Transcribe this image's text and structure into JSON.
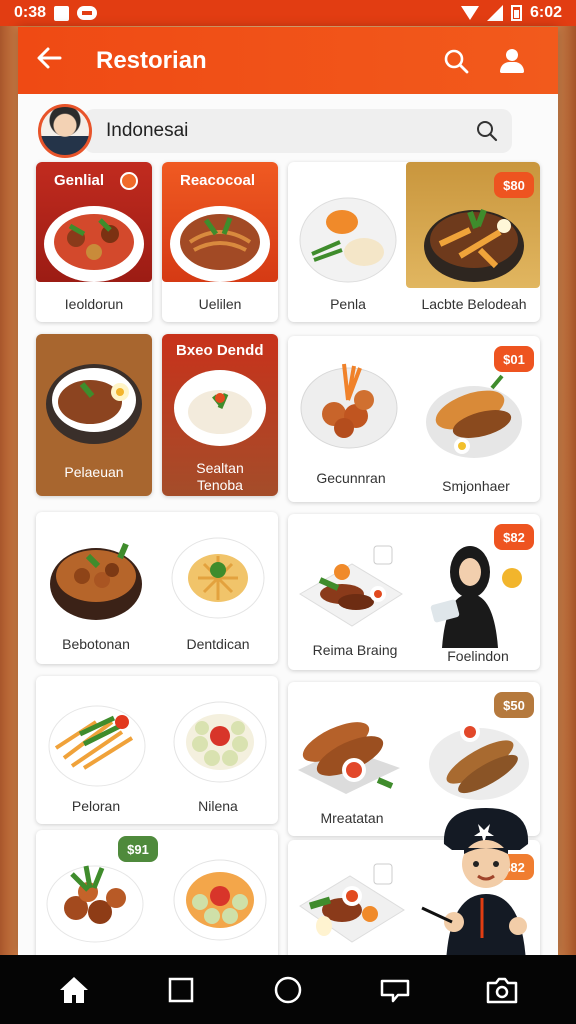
{
  "status": {
    "time": "0:38",
    "right_time": "6:02"
  },
  "appbar": {
    "title": "Restorian",
    "back_icon": "back-arrow-icon",
    "search_icon": "search-icon",
    "profile_icon": "user-icon"
  },
  "search": {
    "value": "Indonesai"
  },
  "cards": {
    "c1": {
      "header": "Genlial",
      "label": "Ieoldorun"
    },
    "c2": {
      "header": "Reacocoal",
      "label": "Uelilen"
    },
    "c3": {
      "label_left": "Penla",
      "label_right": "Lacbte Belodeah",
      "badge": "$80"
    },
    "c4": {
      "label": "Pelaeuan"
    },
    "c5": {
      "header": "Bxeo Dendd",
      "label_line1": "Sealtan",
      "label_line2": "Tenoba"
    },
    "c6": {
      "label_left": "Gecunnran",
      "label_right": "Smjonhaer",
      "badge": "$01"
    },
    "c7": {
      "label_left": "Bebotonan",
      "label_right": "Dentdican"
    },
    "c8": {
      "label_left": "Reima Braing",
      "label_right": "Foelindon",
      "badge": "$82"
    },
    "c9": {
      "label_left": "Peloran",
      "label_right": "Nilena"
    },
    "c10": {
      "label": "Mreatatan",
      "badge": "$50"
    },
    "c11": {
      "badge": "$91"
    },
    "c12": {
      "badge": "$82"
    }
  },
  "colors": {
    "accent": "#ef4a14",
    "badge": "#ee5420",
    "badge_green": "#4f8a3c",
    "dark_red": "#b9261a",
    "brown": "#a8662f"
  }
}
